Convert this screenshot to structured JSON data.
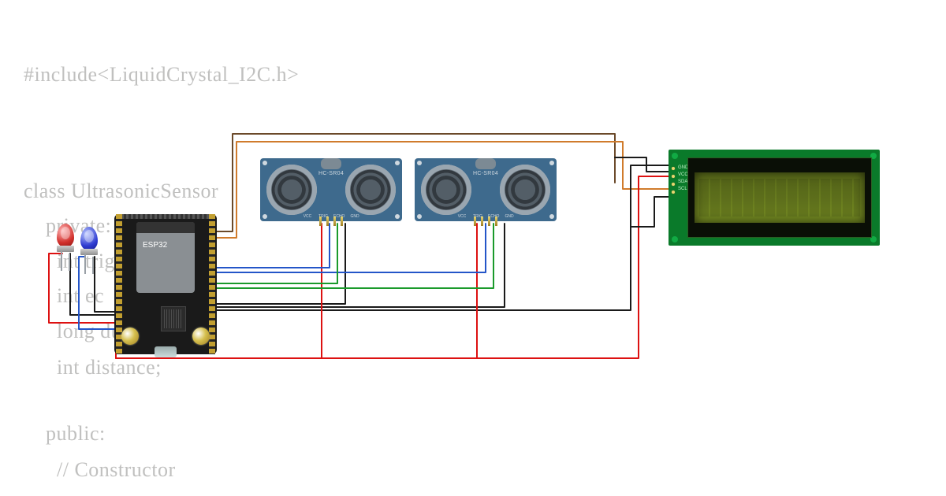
{
  "code": {
    "l1": "#include<LiquidCrystal_I2C.h>",
    "l2": "class UltrasonicSensor",
    "l3": "private:",
    "l4": "int trig",
    "l5": "int ec",
    "l6": "long du",
    "l6b": ";",
    "l7": "int distance;",
    "l8": "public:",
    "l9": "// Constructor"
  },
  "esp32": {
    "label": "ESP32"
  },
  "ultra": {
    "label": "HC-SR04",
    "pins": [
      "VCC",
      "TRIG",
      "ECHO",
      "GND"
    ]
  },
  "lcd": {
    "pins": [
      "GND",
      "VCC",
      "SDA",
      "SCL"
    ]
  },
  "colors": {
    "black": "#1a1a1a",
    "red": "#d11",
    "blue": "#2455c8",
    "green": "#1a9a2b",
    "brown": "#6b4a2a",
    "orange": "#d07b2c",
    "grey": "#888"
  }
}
